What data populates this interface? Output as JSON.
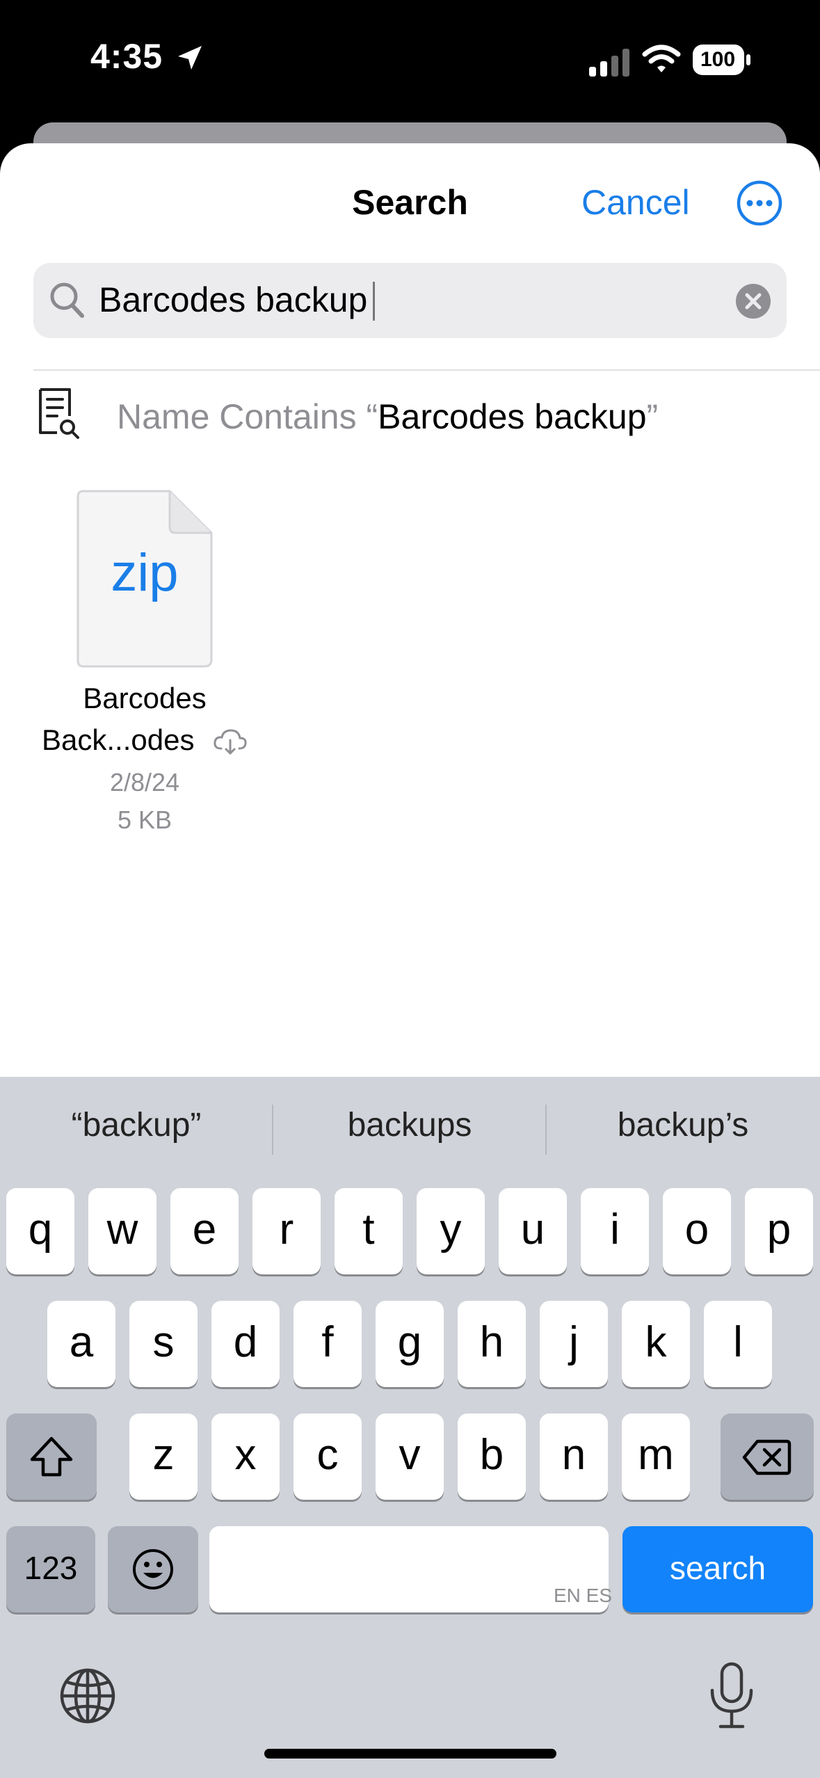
{
  "status_bar": {
    "time": "4:35",
    "battery": "100"
  },
  "header": {
    "title": "Search",
    "cancel_label": "Cancel"
  },
  "search": {
    "query": "Barcodes backup"
  },
  "suggestion": {
    "prefix": "Name Contains “",
    "query": "Barcodes backup",
    "suffix": "”"
  },
  "results": [
    {
      "ext": "zip",
      "name_line1": "Barcodes",
      "name_line2": "Back...odes",
      "date": "2/8/24",
      "size": "5 KB"
    }
  ],
  "keyboard": {
    "predictions": [
      "“backup”",
      "backups",
      "backup’s"
    ],
    "row1": [
      "q",
      "w",
      "e",
      "r",
      "t",
      "y",
      "u",
      "i",
      "o",
      "p"
    ],
    "row2": [
      "a",
      "s",
      "d",
      "f",
      "g",
      "h",
      "j",
      "k",
      "l"
    ],
    "row3": [
      "z",
      "x",
      "c",
      "v",
      "b",
      "n",
      "m"
    ],
    "numbers_label": "123",
    "space_hint": "EN ES",
    "action_label": "search"
  },
  "colors": {
    "accent": "#1a7ee8",
    "keyboard_bg": "#d0d3d9",
    "search_key": "#1283fa"
  }
}
